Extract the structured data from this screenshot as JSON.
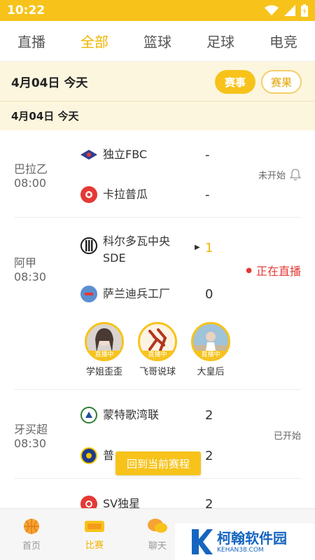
{
  "status_bar": {
    "time": "10:22"
  },
  "tabs": [
    {
      "label": "直播",
      "active": false
    },
    {
      "label": "全部",
      "active": true
    },
    {
      "label": "篮球",
      "active": false
    },
    {
      "label": "足球",
      "active": false
    },
    {
      "label": "电竞",
      "active": false
    }
  ],
  "date_header": {
    "date": "4月04日  今天",
    "event_label": "赛事",
    "result_label": "赛果"
  },
  "date_sub": "4月04日    今天",
  "matches": [
    {
      "league": "巴拉乙",
      "time": "08:00",
      "home": "独立FBC",
      "home_score": "-",
      "away": "卡拉普瓜",
      "away_score": "-",
      "status": "未开始"
    },
    {
      "league": "阿甲",
      "time": "08:30",
      "home": "科尔多瓦中央SDE",
      "home_score": "1",
      "away": "萨兰迪兵工厂",
      "away_score": "0",
      "status": "正在直播",
      "streamers": [
        {
          "name": "学姐歪歪",
          "badge": "直播中"
        },
        {
          "name": "飞哥说球",
          "badge": "直播中"
        },
        {
          "name": "大皇后",
          "badge": "直播中"
        }
      ]
    },
    {
      "league": "牙买超",
      "time": "08:30",
      "home": "蒙特歌湾联",
      "home_score": "2",
      "away": "普",
      "away_score": "2",
      "status": "已开始"
    },
    {
      "home": "SV独星",
      "home_score": "2"
    }
  ],
  "back_button": "回到当前赛程",
  "bottom_nav": [
    {
      "label": "首页",
      "active": false
    },
    {
      "label": "比赛",
      "active": true
    },
    {
      "label": "聊天",
      "active": false
    }
  ],
  "watermark": {
    "cn": "柯翰软件园",
    "en": "KEHAN38.COM"
  },
  "colors": {
    "accent": "#f7c31b",
    "live": "#e53935"
  }
}
